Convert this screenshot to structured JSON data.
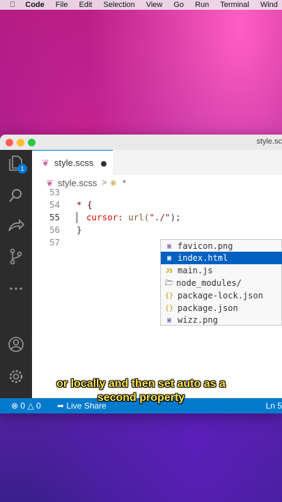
{
  "menubar": {
    "apple": "",
    "app": "Code",
    "items": [
      "File",
      "Edit",
      "Selection",
      "View",
      "Go",
      "Run",
      "Terminal",
      "Wind"
    ]
  },
  "window": {
    "title": "style.sc"
  },
  "activity": {
    "explorer_badge": "1"
  },
  "tab": {
    "name": "style.scss",
    "icon": "sass-icon"
  },
  "breadcrumb": {
    "file": "style.scss",
    "separator": ">",
    "symbol": "*"
  },
  "code_lines": [
    {
      "num": "53",
      "text": ""
    },
    {
      "num": "54",
      "text": "* {"
    },
    {
      "num": "55",
      "text": "cursor: url(\"./\");"
    },
    {
      "num": "56",
      "text": "}"
    },
    {
      "num": "57",
      "text": ""
    }
  ],
  "suggestions": [
    {
      "label": "favicon.png",
      "icon": "image-file-icon"
    },
    {
      "label": "index.html",
      "icon": "html-file-icon",
      "selected": true
    },
    {
      "label": "main.js",
      "icon": "js-file-icon"
    },
    {
      "label": "node_modules/",
      "icon": "folder-icon"
    },
    {
      "label": "package-lock.json",
      "icon": "json-file-icon"
    },
    {
      "label": "package.json",
      "icon": "json-file-icon"
    },
    {
      "label": "wizz.png",
      "icon": "image-file-icon"
    }
  ],
  "caption": {
    "line1": "or locally and then set auto as a",
    "line2": "second property"
  },
  "statusbar": {
    "errors": "0",
    "warnings": "0",
    "live_share": "Live Share",
    "position": "Ln 5"
  },
  "colors": {
    "accent": "#007acc",
    "selection": "#0060c0",
    "activity_bar": "#2c2c2c"
  }
}
